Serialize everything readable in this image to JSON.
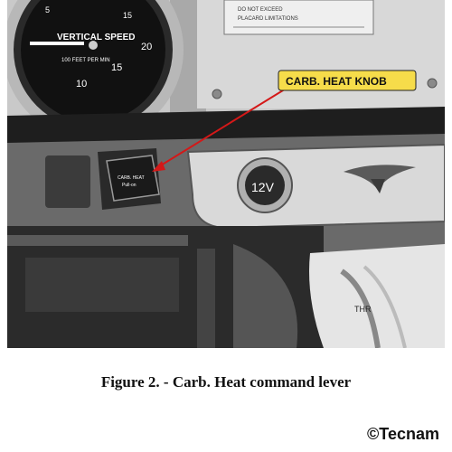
{
  "photo": {
    "callout_label": "CARB. HEAT KNOB",
    "gauge_title": "VERTICAL SPEED",
    "gauge_units": "100 FEET PER MIN",
    "gauge_numbers": [
      "5",
      "10",
      "15",
      "20",
      "15"
    ],
    "knob_text_line1": "CARB. HEAT",
    "knob_text_line2": "Pull-on",
    "outlet_label": "12V",
    "throttle_text": "THR",
    "placard_line1": "DO NOT EXCEED",
    "placard_line2": "PLACARD LIMITATIONS",
    "colors": {
      "callout_fill": "#f6dc4a",
      "arrow": "#d41818"
    }
  },
  "caption": "Figure 2. - Carb. Heat command lever",
  "credit": "©Tecnam"
}
